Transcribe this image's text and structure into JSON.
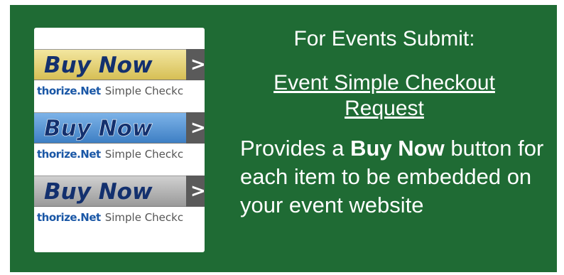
{
  "preview": {
    "buttons": [
      {
        "label": "Buy Now",
        "arrow": ">",
        "brand": "thorize.Net",
        "caption": "Simple Checkc",
        "color": "#e8d37a"
      },
      {
        "label": "Buy Now",
        "arrow": ">",
        "brand": "thorize.Net",
        "caption": "Simple Checkc",
        "color": "#4f8fd3"
      },
      {
        "label": "Buy Now",
        "arrow": ">",
        "brand": "thorize.Net",
        "caption": "Simple Checkc",
        "color": "#b5b5b5"
      }
    ]
  },
  "content": {
    "heading": "For Events Submit:",
    "link_text": "Event Simple Checkout Request",
    "desc_prefix": "Provides a ",
    "desc_bold": "Buy Now",
    "desc_suffix": " button for each item to be embedded on your event website"
  },
  "colors": {
    "panel_bg": "#1f6b34",
    "text": "#ffffff"
  }
}
